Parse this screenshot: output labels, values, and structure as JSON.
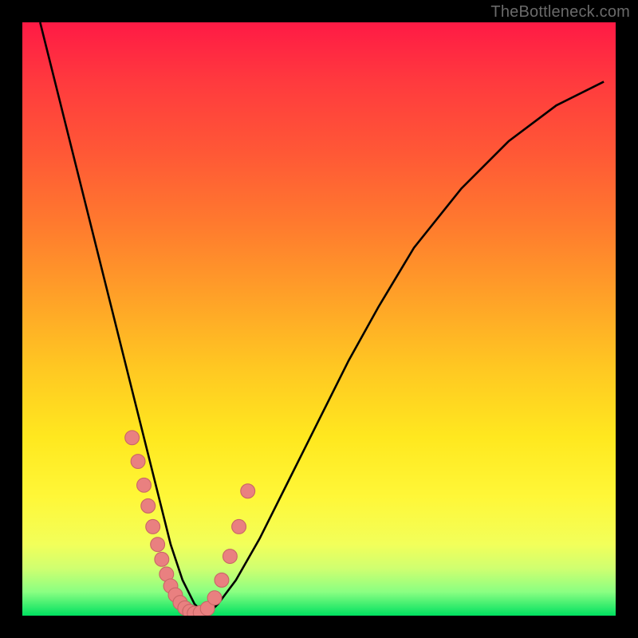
{
  "watermark": "TheBottleneck.com",
  "colors": {
    "frame_bg": "#000000",
    "curve": "#000000",
    "dot_fill": "#e98080",
    "dot_stroke": "#c96666"
  },
  "chart_data": {
    "type": "line",
    "title": "",
    "xlabel": "",
    "ylabel": "",
    "xlim": [
      0,
      100
    ],
    "ylim": [
      0,
      100
    ],
    "series": [
      {
        "name": "bottleneck-curve",
        "x": [
          3,
          5,
          7,
          9,
          11,
          13,
          15,
          17,
          19,
          21,
          23,
          25,
          27,
          29,
          31,
          33,
          36,
          40,
          45,
          50,
          55,
          60,
          66,
          74,
          82,
          90,
          98
        ],
        "y": [
          100,
          92,
          84,
          76,
          68,
          60,
          52,
          44,
          36,
          28,
          20,
          12,
          6,
          2,
          0,
          2,
          6,
          13,
          23,
          33,
          43,
          52,
          62,
          72,
          80,
          86,
          90
        ]
      }
    ],
    "dots": {
      "name": "sample-points",
      "x": [
        18.5,
        19.5,
        20.5,
        21.2,
        22.0,
        22.8,
        23.5,
        24.3,
        25.0,
        25.8,
        26.6,
        27.4,
        28.2,
        29.0,
        30.0,
        31.2,
        32.4,
        33.6,
        35.0,
        36.5,
        38.0
      ],
      "y": [
        30.0,
        26.0,
        22.0,
        18.5,
        15.0,
        12.0,
        9.5,
        7.0,
        5.0,
        3.5,
        2.2,
        1.3,
        0.7,
        0.4,
        0.5,
        1.2,
        3.0,
        6.0,
        10.0,
        15.0,
        21.0
      ]
    }
  }
}
